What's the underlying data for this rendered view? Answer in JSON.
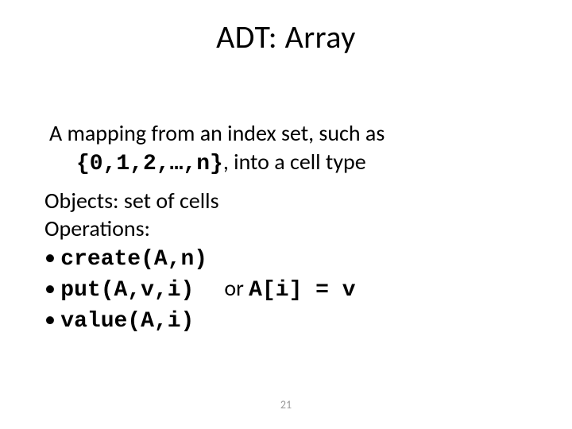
{
  "title": "ADT: Array",
  "para1": {
    "line1": "A mapping from an index set,  such as",
    "indexset": "{0,1,2,…,n}",
    "after_indexset": ", into a cell type"
  },
  "objects_label": "Objects:",
  "objects_rest": " set of cells",
  "operations_label": "Operations:",
  "ops": {
    "create": "create(A,n)",
    "put": "put(A,v,i)",
    "put_or": "or ",
    "put_alt": "A[i] = v",
    "value": "value(A,i)"
  },
  "page_number": "21"
}
